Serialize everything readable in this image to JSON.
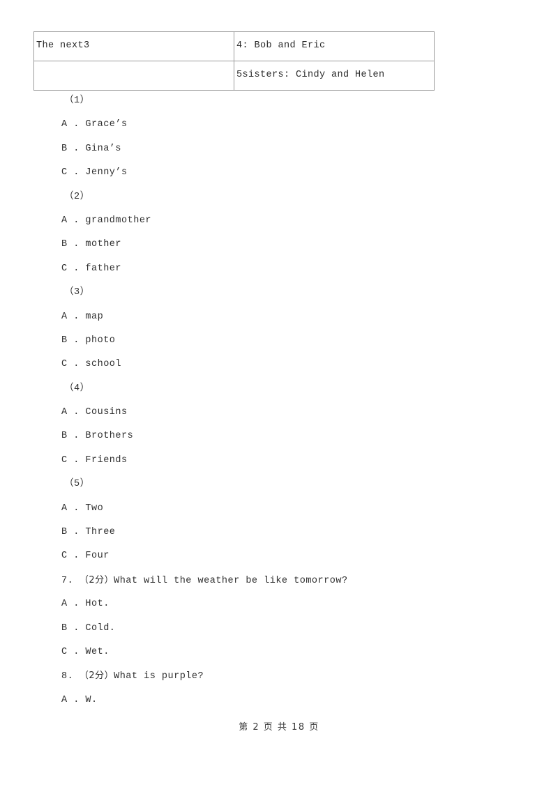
{
  "document": {
    "type": "exam-paper",
    "table": {
      "rows": [
        {
          "left": "The next3",
          "right": "4: Bob and Eric"
        },
        {
          "left": "",
          "right": "5sisters: Cindy and Helen"
        }
      ]
    },
    "blocks": [
      {
        "label": "（1）",
        "options": [
          "A . Grace’s",
          "B . Gina’s",
          "C . Jenny’s"
        ]
      },
      {
        "label": "（2）",
        "options": [
          "A . grandmother",
          "B . mother",
          "C . father"
        ]
      },
      {
        "label": "（3）",
        "options": [
          "A . map",
          "B . photo",
          "C . school"
        ]
      },
      {
        "label": "（4）",
        "options": [
          "A . Cousins",
          "B . Brothers",
          "C . Friends"
        ]
      },
      {
        "label": "（5）",
        "options": [
          "A . Two",
          "B . Three",
          "C . Four"
        ]
      }
    ],
    "questions": [
      {
        "number": "7.",
        "marks": "（2分）",
        "stem": "What will the weather be like tomorrow?",
        "options": [
          "A . Hot.",
          "B . Cold.",
          "C . Wet."
        ]
      },
      {
        "number": "8.",
        "marks": "（2分）",
        "stem": "What is purple?",
        "options": [
          "A . W."
        ]
      }
    ],
    "footer": "第 2 页 共 18 页"
  }
}
